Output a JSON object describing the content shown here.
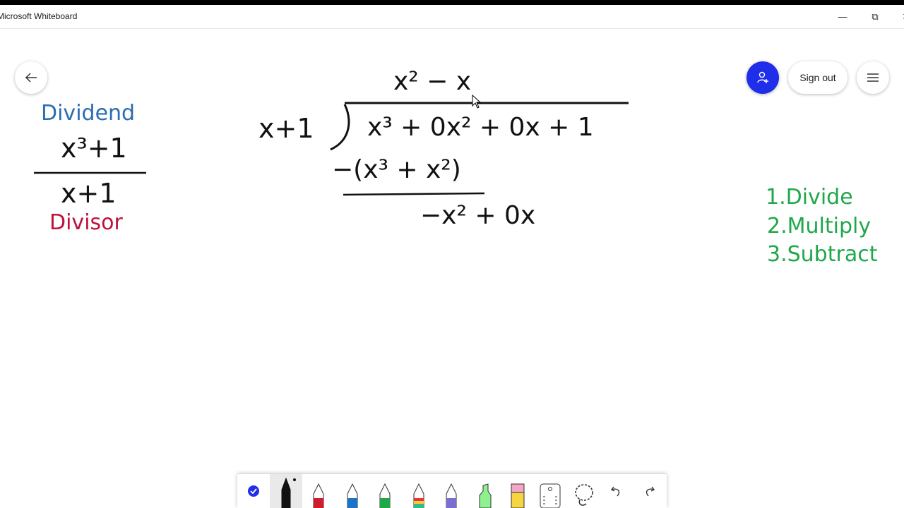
{
  "window": {
    "title": "Microsoft Whiteboard",
    "minimize_icon": "—",
    "restore_icon": "⧉",
    "close_icon": "✕"
  },
  "header": {
    "sign_out_label": "Sign out"
  },
  "board": {
    "dividend_label": "Dividend",
    "dividend_expr": "x³+1",
    "divisor_expr": "x+1",
    "divisor_label": "Divisor",
    "quotient": "x² − x",
    "long_divisor": "x+1",
    "long_dividend": "x³ + 0x² + 0x + 1",
    "subtract_line": "−(x³ + x²)",
    "remainder_line": "−x² + 0x",
    "steps": [
      "1.Divide",
      "2.Multiply",
      "3.Subtract"
    ]
  },
  "colors": {
    "dividend_label": "#2a6db0",
    "divisor_label": "#c0103c",
    "steps": "#1fa84a",
    "share_button": "#1f2ee8"
  },
  "toolbar": {
    "tools": [
      "select-tool",
      "black-pen",
      "red-pen",
      "blue-pen",
      "green-pen",
      "rainbow-pen",
      "galaxy-pen",
      "highlighter",
      "eraser",
      "ruler",
      "lasso",
      "undo",
      "redo"
    ]
  }
}
